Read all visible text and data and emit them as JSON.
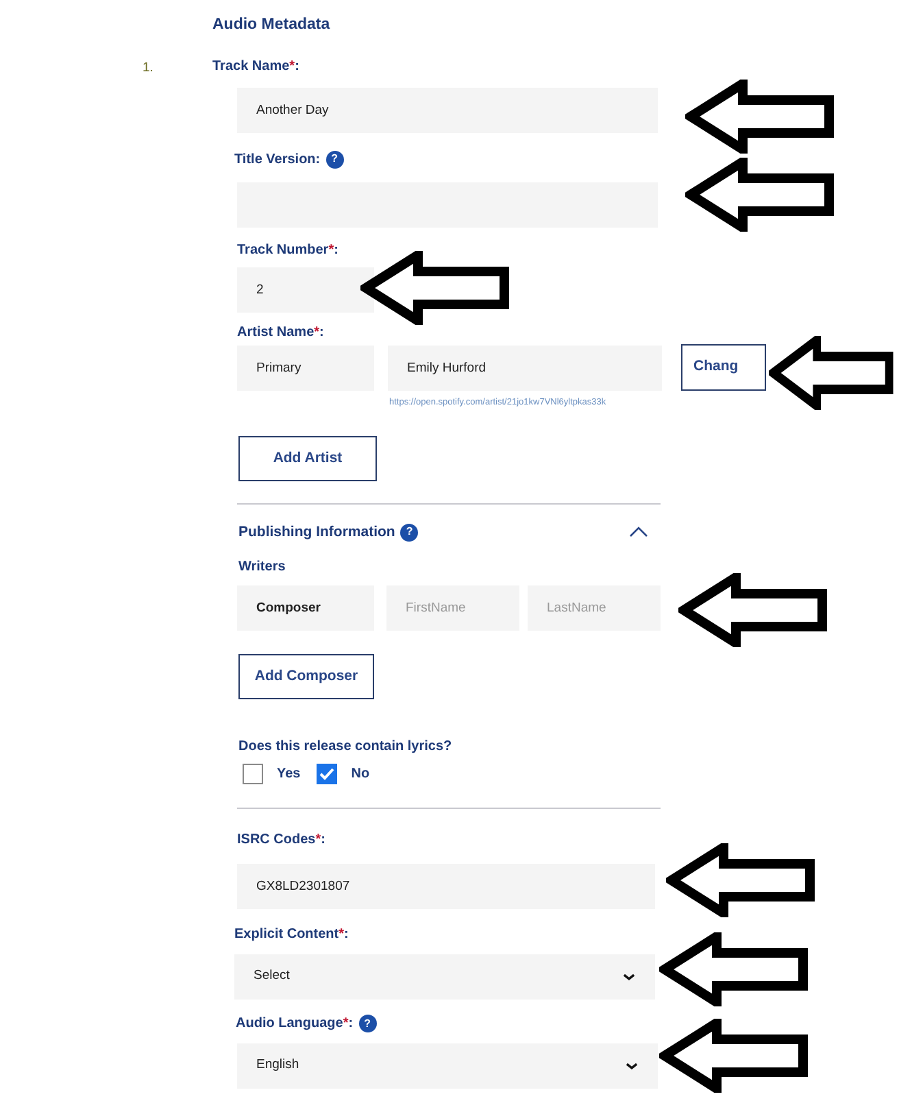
{
  "section_title": "Audio Metadata",
  "track_index": "1.",
  "track_name": {
    "label": "Track Name",
    "required_mark": "*",
    "label_end": ":",
    "value": "Another Day"
  },
  "title_version": {
    "label": "Title Version:",
    "help": "?"
  },
  "track_number": {
    "label": "Track Number",
    "required_mark": "*",
    "label_end": ":",
    "value": "2"
  },
  "artist": {
    "label": "Artist Name",
    "required_mark": "*",
    "label_end": ":",
    "role": "Primary",
    "name": "Emily Hurford",
    "link": "https://open.spotify.com/artist/21jo1kw7VNl6yltpkas33k",
    "change_button": "Chang"
  },
  "add_artist_button": "Add Artist",
  "publishing": {
    "title": "Publishing Information",
    "help": "?",
    "expanded": true
  },
  "writers": {
    "label": "Writers",
    "role": "Composer",
    "first_placeholder": "FirstName",
    "last_placeholder": "LastName"
  },
  "add_composer_button": "Add Composer",
  "lyrics": {
    "question": "Does this release contain lyrics?",
    "options": [
      {
        "label": "Yes",
        "checked": false
      },
      {
        "label": "No",
        "checked": true
      }
    ]
  },
  "isrc": {
    "label": "ISRC Codes",
    "required_mark": "*",
    "label_end": ":",
    "value": "GX8LD2301807"
  },
  "explicit": {
    "label": "Explicit Content",
    "required_mark": "*",
    "label_end": ":",
    "value": "Select"
  },
  "language": {
    "label": "Audio Language",
    "required_mark": "*",
    "label_end": ":",
    "help": "?",
    "value": "English"
  }
}
